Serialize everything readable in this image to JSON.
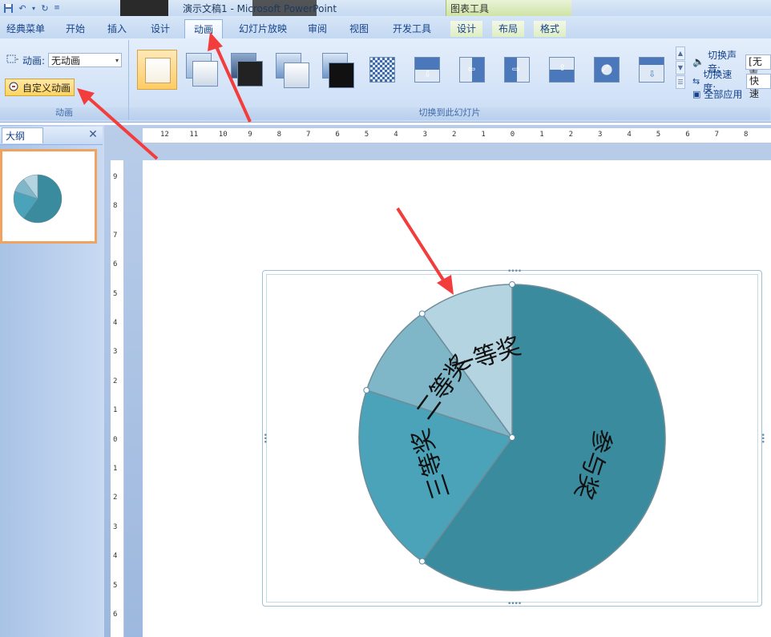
{
  "window": {
    "title": "演示文稿1 - Microsoft PowerPoint",
    "context_tab_group": "图表工具"
  },
  "quick_access": [
    "save-icon",
    "undo-icon",
    "dropdown-icon",
    "redo-icon",
    "customize-icon"
  ],
  "tabs": [
    {
      "label": "经典菜单"
    },
    {
      "label": "开始"
    },
    {
      "label": "插入"
    },
    {
      "label": "设计"
    },
    {
      "label": "动画",
      "active": true
    },
    {
      "label": "幻灯片放映"
    },
    {
      "label": "审阅"
    },
    {
      "label": "视图"
    },
    {
      "label": "开发工具"
    },
    {
      "label": "设计",
      "contextual": true
    },
    {
      "label": "布局",
      "contextual": true
    },
    {
      "label": "格式",
      "contextual": true
    }
  ],
  "animation_group": {
    "animation_label": "动画:",
    "animation_value": "无动画",
    "custom_animation": "自定义动画",
    "group_label": "动画"
  },
  "transition_group": {
    "group_label": "切换到此幻灯片",
    "sound_label": "切换声音:",
    "sound_value": "[无声",
    "speed_label": "切换速度:",
    "speed_value": "快速",
    "apply_all": "全部应用"
  },
  "outline_pane": {
    "tab_label": "大纲",
    "close": "✕"
  },
  "rulers": {
    "horizontal": [
      "12",
      "11",
      "10",
      "9",
      "8",
      "7",
      "6",
      "5",
      "4",
      "3",
      "2",
      "1",
      "0",
      "1",
      "2",
      "3",
      "4",
      "5",
      "6",
      "7",
      "8"
    ],
    "vertical": [
      "9",
      "8",
      "7",
      "6",
      "5",
      "4",
      "3",
      "2",
      "1",
      "0",
      "1",
      "2",
      "3",
      "4",
      "5",
      "6"
    ]
  },
  "colors": {
    "accent": "#ffd55d",
    "arrow": "#f33c3c",
    "slice_participation": "#3b8b9e",
    "slice_third": "#4aa3b9",
    "slice_second": "#7fb7c9",
    "slice_first": "#b3d4e0"
  },
  "chart_data": {
    "type": "pie",
    "categories": [
      "参与奖",
      "三等奖",
      "二等奖",
      "一等奖"
    ],
    "values": [
      60,
      20,
      10,
      10
    ],
    "title": ""
  }
}
